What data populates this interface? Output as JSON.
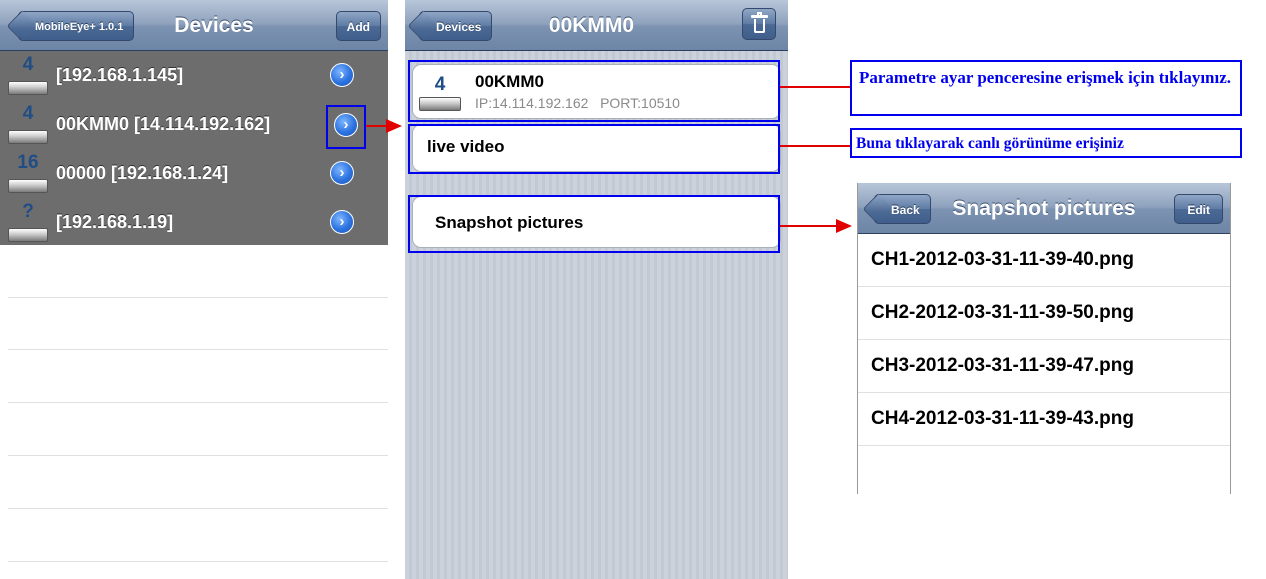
{
  "left_screen": {
    "back_button": "MobileEye+ 1.0.1",
    "title": "Devices",
    "add_button": "Add",
    "devices": [
      {
        "badge": "4",
        "label": " [192.168.1.145]"
      },
      {
        "badge": "4",
        "label": "00KMM0 [14.114.192.162]"
      },
      {
        "badge": "16",
        "label": "00000 [192.168.1.24]"
      },
      {
        "badge": "?",
        "label": " [192.168.1.19]"
      }
    ],
    "disclosure_glyph": "›"
  },
  "middle_screen": {
    "back_button": "Devices",
    "title": "00KMM0",
    "device_cell": {
      "badge": "4",
      "name": "00KMM0",
      "detail": "IP:14.114.192.162   PORT:10510"
    },
    "live_video_label": "live video",
    "snapshot_label": "Snapshot pictures",
    "trash_icon": "trash-icon"
  },
  "callouts": {
    "parametre": "Parametre ayar penceresine erişmek için tıklayınız.",
    "live": "Buna tıklayarak canlı görünüme erişiniz"
  },
  "right_screen": {
    "back_button": "Back",
    "title": "Snapshot pictures",
    "edit_button": "Edit",
    "files": [
      "CH1-2012-03-31-11-39-40.png",
      "CH2-2012-03-31-11-39-50.png",
      "CH3-2012-03-31-11-39-47.png",
      "CH4-2012-03-31-11-39-43.png"
    ]
  },
  "colors": {
    "annotation_blue": "#0000ee",
    "annotation_red": "#e00000",
    "navbar": "#7d93b2",
    "device_list_bg": "#6d6d6d"
  }
}
